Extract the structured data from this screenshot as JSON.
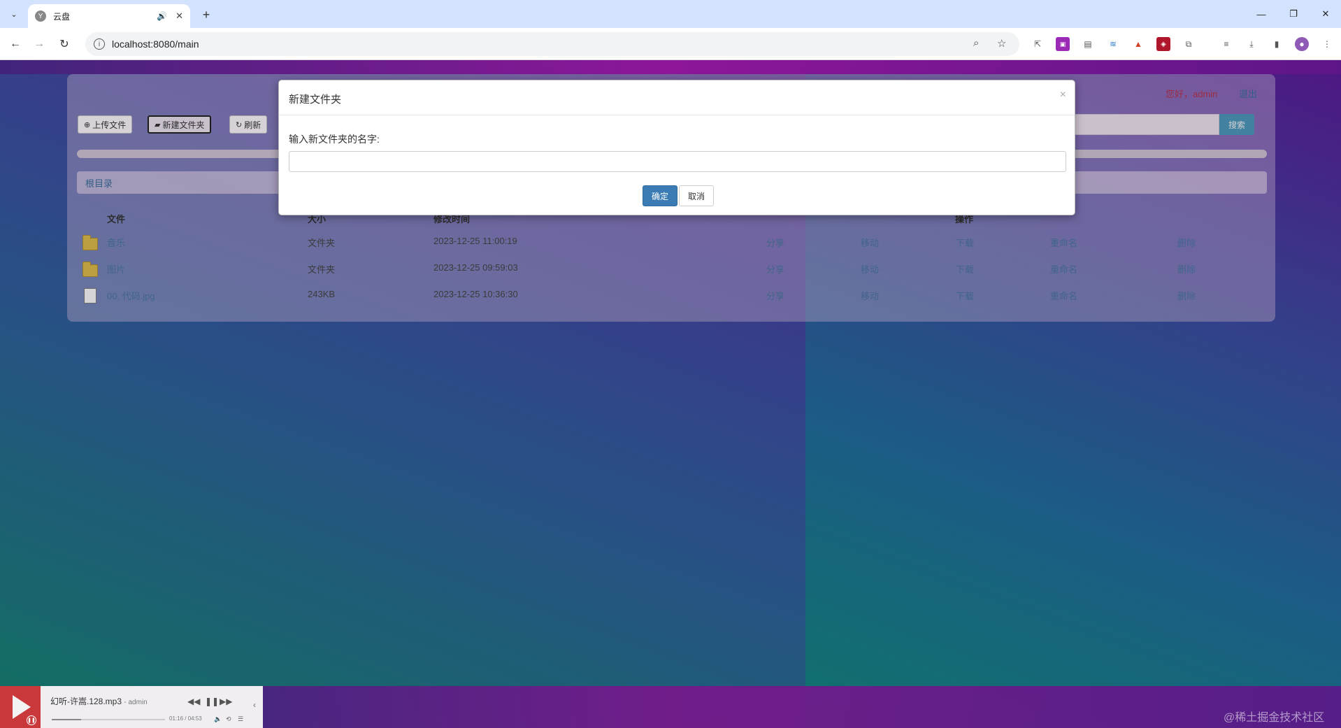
{
  "browser": {
    "tab_title": "云盘",
    "url": "localhost:8080/main"
  },
  "header": {
    "greeting": "您好，admin",
    "logout": "退出",
    "search_button": "搜索"
  },
  "toolbar": {
    "upload": "上传文件",
    "new_folder": "新建文件夹",
    "refresh": "刷新"
  },
  "breadcrumb": "根目录",
  "table": {
    "headers": [
      "文件",
      "大小",
      "修改时间",
      "操作"
    ],
    "rows": [
      {
        "name": "音乐",
        "size": "文件夹",
        "mtime": "2023-12-25 11:00:19",
        "type": "folder"
      },
      {
        "name": "图片",
        "size": "文件夹",
        "mtime": "2023-12-25 09:59:03",
        "type": "folder"
      },
      {
        "name": "00. 代码.jpg",
        "size": "243KB",
        "mtime": "2023-12-25 10:36:30",
        "type": "file"
      }
    ],
    "actions": [
      "分享",
      "移动",
      "下载",
      "重命名",
      "删除"
    ]
  },
  "modal": {
    "title": "新建文件夹",
    "close": "×",
    "label": "输入新文件夹的名字:",
    "input_value": "",
    "ok": "确定",
    "cancel": "取消"
  },
  "player": {
    "song": "幻听-许嵩.128.mp3",
    "artist": "admin",
    "time": "01:16 / 04:53",
    "progress": 0.26
  },
  "watermark": "@稀土掘金技术社区",
  "colors": {
    "accent": "#3a7cb3",
    "link": "#4a73a0",
    "greeting": "#b2324a"
  }
}
